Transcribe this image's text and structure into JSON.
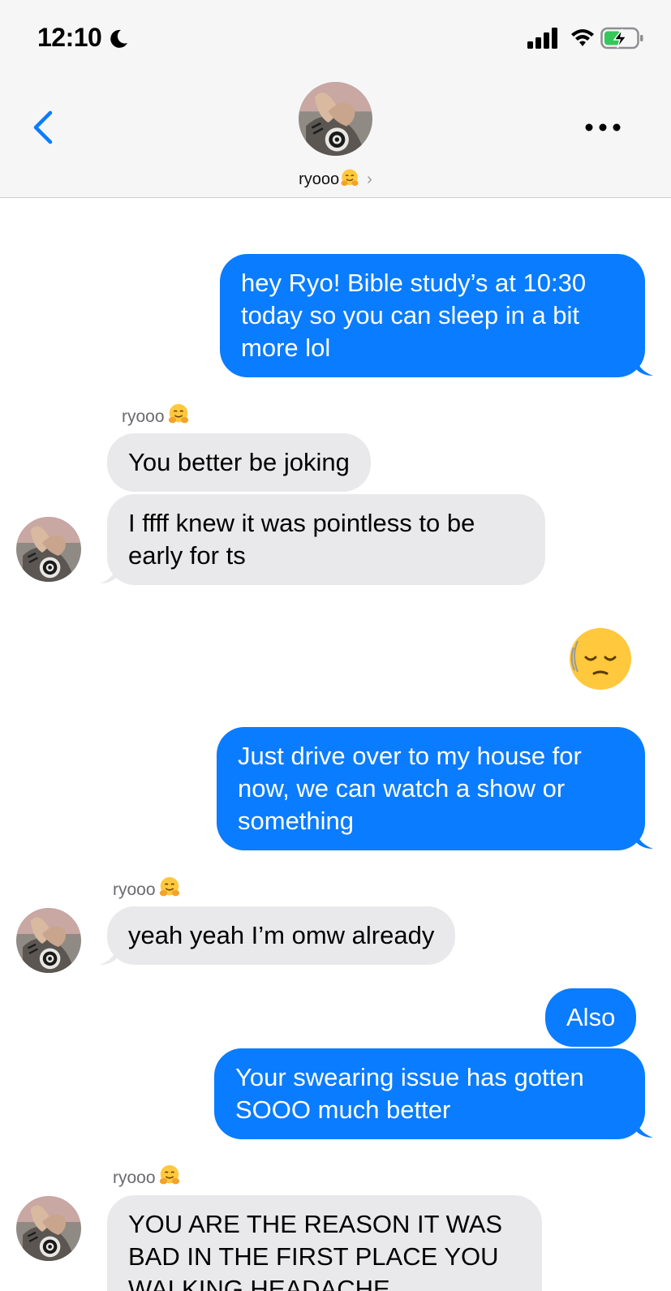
{
  "status_bar": {
    "time": "12:10",
    "icons": [
      "moon-icon",
      "cellular-signal-icon",
      "wifi-icon",
      "battery-charging-icon"
    ]
  },
  "nav": {
    "contact_name": "ryooo",
    "contact_emoji": "hugging-face-emoji",
    "chevron": "›",
    "icons": [
      "back-chevron-icon",
      "more-options-icon"
    ]
  },
  "colors": {
    "sent_bubble": "#0a7cff",
    "received_bubble": "#e9e9eb",
    "header_bg": "#f6f6f7"
  },
  "messages": [
    {
      "from": "me",
      "lines": [
        "hey Ryo! Bible study’s at 10:30",
        "today so you can sleep in a bit",
        "more lol"
      ]
    },
    {
      "sender_label": "ryooo"
    },
    {
      "from": "ryooo",
      "lines": [
        "You better be joking"
      ]
    },
    {
      "from": "ryooo",
      "lines": [
        "I ffff knew it was pointless to be",
        "early for ts"
      ]
    },
    {
      "from": "me",
      "emoji": "sad-relieved-face-emoji"
    },
    {
      "from": "me",
      "lines": [
        "Just drive over to my house for",
        "now, we can watch a show or",
        "something"
      ]
    },
    {
      "sender_label": "ryooo"
    },
    {
      "from": "ryooo",
      "lines": [
        "yeah yeah I’m omw already"
      ]
    },
    {
      "from": "me",
      "lines": [
        "Also"
      ]
    },
    {
      "from": "me",
      "lines": [
        "Your swearing issue has gotten",
        "SOOO much better"
      ]
    },
    {
      "sender_label": "ryooo"
    },
    {
      "from": "ryooo",
      "lines": [
        "YOU ARE THE REASON IT WAS",
        "BAD IN THE FIRST PLACE YOU",
        "WALKING HEADACHE"
      ]
    }
  ]
}
